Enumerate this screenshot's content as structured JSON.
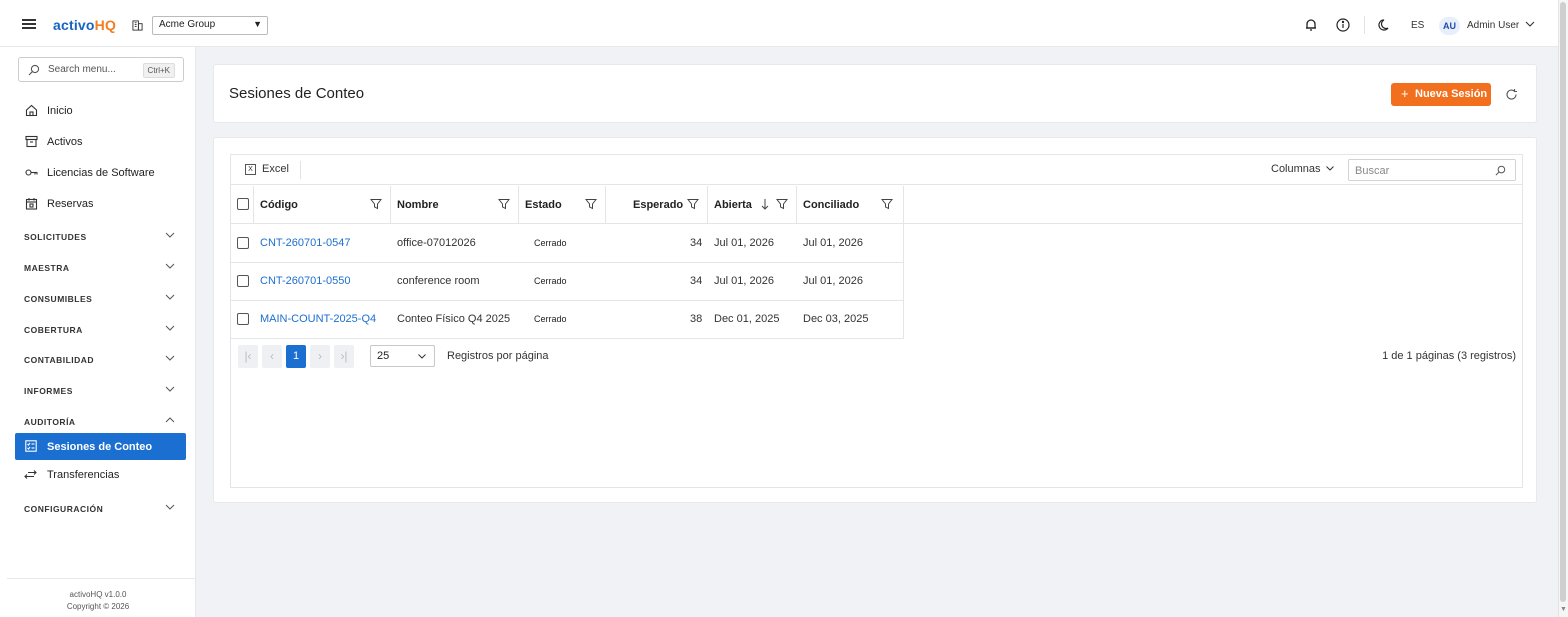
{
  "app": {
    "logo_part1": "activo",
    "logo_part2": "HQ",
    "organization": "Acme Group",
    "language": "ES",
    "user_initials": "AU",
    "user_name": "Admin User"
  },
  "sidebar": {
    "search_placeholder": "Search menu...",
    "search_shortcut": "Ctrl+K",
    "items": [
      {
        "label": "Inicio",
        "icon": "home-icon"
      },
      {
        "label": "Activos",
        "icon": "archive-icon"
      },
      {
        "label": "Licencias de Software",
        "icon": "key-icon"
      },
      {
        "label": "Reservas",
        "icon": "calendar-icon"
      }
    ],
    "sections": [
      {
        "label": "SOLICITUDES",
        "expanded": false
      },
      {
        "label": "MAESTRA",
        "expanded": false
      },
      {
        "label": "CONSUMIBLES",
        "expanded": false
      },
      {
        "label": "COBERTURA",
        "expanded": false
      },
      {
        "label": "CONTABILIDAD",
        "expanded": false
      },
      {
        "label": "INFORMES",
        "expanded": false
      },
      {
        "label": "AUDITORÍA",
        "expanded": true
      },
      {
        "label": "CONFIGURACIÓN",
        "expanded": false
      }
    ],
    "audit_items": [
      {
        "label": "Sesiones de Conteo",
        "active": true
      },
      {
        "label": "Transferencias",
        "active": false
      }
    ],
    "version": "activoHQ v1.0.0",
    "copyright": "Copyright © 2026"
  },
  "page": {
    "title": "Sesiones de Conteo",
    "new_button": "Nueva Sesión"
  },
  "grid": {
    "excel_label": "Excel",
    "columns_label": "Columnas",
    "search_placeholder": "Buscar",
    "headers": [
      "Código",
      "Nombre",
      "Estado",
      "Esperado",
      "Abierta",
      "Conciliado"
    ],
    "rows": [
      {
        "codigo": "CNT-260701-0547",
        "nombre": "office-07012026",
        "estado": "Cerrado",
        "esperado": "34",
        "abierta": "Jul 01, 2026",
        "conciliado": "Jul 01, 2026"
      },
      {
        "codigo": "CNT-260701-0550",
        "nombre": "conference room",
        "estado": "Cerrado",
        "esperado": "34",
        "abierta": "Jul 01, 2026",
        "conciliado": "Jul 01, 2026"
      },
      {
        "codigo": "MAIN-COUNT-2025-Q4",
        "nombre": "Conteo Físico Q4 2025",
        "estado": "Cerrado",
        "esperado": "38",
        "abierta": "Dec 01, 2025",
        "conciliado": "Dec 03, 2025"
      }
    ],
    "pager": {
      "current_page": "1",
      "page_size": "25",
      "per_page_label": "Registros por página",
      "info": "1 de 1 páginas (3 registros)"
    }
  },
  "colors": {
    "primary": "#1b6fd1",
    "accent": "#f26f1d"
  }
}
